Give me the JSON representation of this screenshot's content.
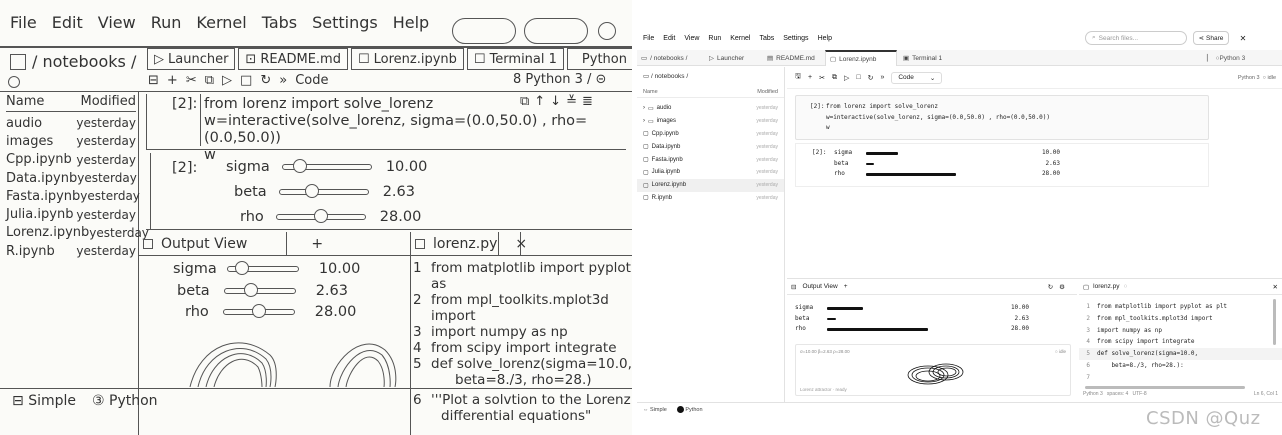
{
  "sketch": {
    "menu": [
      "File",
      "Edit",
      "View",
      "Run",
      "Kernel",
      "Tabs",
      "Settings",
      "Help"
    ],
    "path": "/ notebooks /",
    "tabs": [
      "Launcher",
      "README.md",
      "Lorenz.ipynb",
      "Terminal 1",
      "Python 3"
    ],
    "toolbar_code": "Code",
    "kernel": "8 Python 3",
    "files_header": {
      "name": "Name",
      "modified": "Modified"
    },
    "files": [
      {
        "name": "audio",
        "modified": "yesterday"
      },
      {
        "name": "images",
        "modified": "yesterday"
      },
      {
        "name": "Cpp.ipynb",
        "modified": "yesterday"
      },
      {
        "name": "Data.ipynb",
        "modified": "yesterday"
      },
      {
        "name": "Fasta.ipynb",
        "modified": "yesterday"
      },
      {
        "name": "Julia.ipynb",
        "modified": "yesterday"
      },
      {
        "name": "Lorenz.ipynb",
        "modified": "yesterday"
      },
      {
        "name": "R.ipynb",
        "modified": "yesterday"
      }
    ],
    "cell_prompt": "[2]:",
    "cell_code": [
      "from lorenz import solve_lorenz",
      "w=interactive(solve_lorenz, sigma=(0.0,50.0) , rho=(0.0,50.0))",
      "w"
    ],
    "out_prompt": "[2]:",
    "sliders": [
      {
        "label": "sigma",
        "value": "10.00",
        "fraction": 0.2
      },
      {
        "label": "beta",
        "value": "2.63",
        "fraction": 0.37
      },
      {
        "label": "rho",
        "value": "28.00",
        "fraction": 0.5
      }
    ],
    "output_view_title": "Output View",
    "output_sliders": [
      {
        "label": "sigma",
        "value": "10.00"
      },
      {
        "label": "beta",
        "value": "2.63"
      },
      {
        "label": "rho",
        "value": "28.00"
      }
    ],
    "py_tab": "lorenz.py",
    "py_lines": [
      "from matplotlib import pyplot as",
      "from mpl_toolkits.mplot3d import",
      "import numpy as np",
      "from scipy import integrate",
      "def solve_lorenz(sigma=10.0,",
      "beta=8./3, rho=28.)",
      "'''Plot a solvtion to the Lorenz",
      "differential equations\""
    ],
    "py_line_numbers": [
      "1",
      "2",
      "3",
      "4",
      "5",
      "",
      "6",
      ""
    ],
    "status": {
      "mode": "Simple",
      "kernel": "Python"
    }
  },
  "jl": {
    "menu": [
      "File",
      "Edit",
      "View",
      "Run",
      "Kernel",
      "Tabs",
      "Settings",
      "Help"
    ],
    "search_placeholder": "Search files...",
    "share_label": "Share",
    "tabs": [
      "/ notebooks /",
      "Launcher",
      "README.md",
      "Lorenz.ipynb",
      "Terminal 1"
    ],
    "kernel_tab": "Python 3",
    "crumb": "/ notebooks /",
    "files_header": {
      "name": "Name",
      "modified": "Modified"
    },
    "files": [
      {
        "name": "audio",
        "modified": "yesterday"
      },
      {
        "name": "images",
        "modified": "yesterday"
      },
      {
        "name": "Cpp.ipynb",
        "modified": "yesterday"
      },
      {
        "name": "Data.ipynb",
        "modified": "yesterday"
      },
      {
        "name": "Fasta.ipynb",
        "modified": "yesterday"
      },
      {
        "name": "Julia.ipynb",
        "modified": "yesterday"
      },
      {
        "name": "Lorenz.ipynb",
        "modified": "yesterday"
      },
      {
        "name": "R.ipynb",
        "modified": "yesterday"
      }
    ],
    "toolbar_code": "Code",
    "kernel_status": "Python 3",
    "kernel_idle": "idle",
    "cell_prompt": "[2]:",
    "cell_code": [
      "from lorenz import solve_lorenz",
      "w=interactive(solve_lorenz, sigma=(0.0,50.0) , rho=(0.0,50.0))",
      "w"
    ],
    "out_prompt": "[2]:",
    "sliders": [
      {
        "label": "sigma",
        "value": "10.00",
        "fraction": 0.2
      },
      {
        "label": "beta",
        "value": "2.63",
        "fraction": 0.05
      },
      {
        "label": "rho",
        "value": "28.00",
        "fraction": 0.56
      }
    ],
    "output_view_title": "Output View",
    "output_sliders": [
      {
        "label": "sigma",
        "value": "10.00",
        "fraction": 0.2
      },
      {
        "label": "beta",
        "value": "2.63",
        "fraction": 0.05
      },
      {
        "label": "rho",
        "value": "28.00",
        "fraction": 0.56
      }
    ],
    "plot_caption": "σ=10.00 β=2.63 ρ=28.00",
    "plot_idle": "idle",
    "plot_footer": "Lorenz attractor · ready",
    "py_tab": "lorenz.py",
    "py_lines": [
      "from matplotlib import pyplot as plt",
      "from mpl_toolkits.mplot3d import",
      "import numpy as np",
      "from scipy import integrate",
      "def solve_lorenz(sigma=10.0,",
      "    beta=8./3, rho=28.):"
    ],
    "py_line_numbers": [
      "1",
      "2",
      "3",
      "4",
      "5",
      "6",
      "7"
    ],
    "py_status": {
      "left": "Python 3",
      "spaces": "spaces: 4",
      "enc": "UTF-8",
      "pos": "Ln 6, Col 1"
    },
    "status": {
      "mode": "Simple",
      "kernel": "Python"
    },
    "colors": {
      "accent": "#111111",
      "border": "#e2e2e2"
    }
  },
  "watermark": "CSDN @Quz"
}
